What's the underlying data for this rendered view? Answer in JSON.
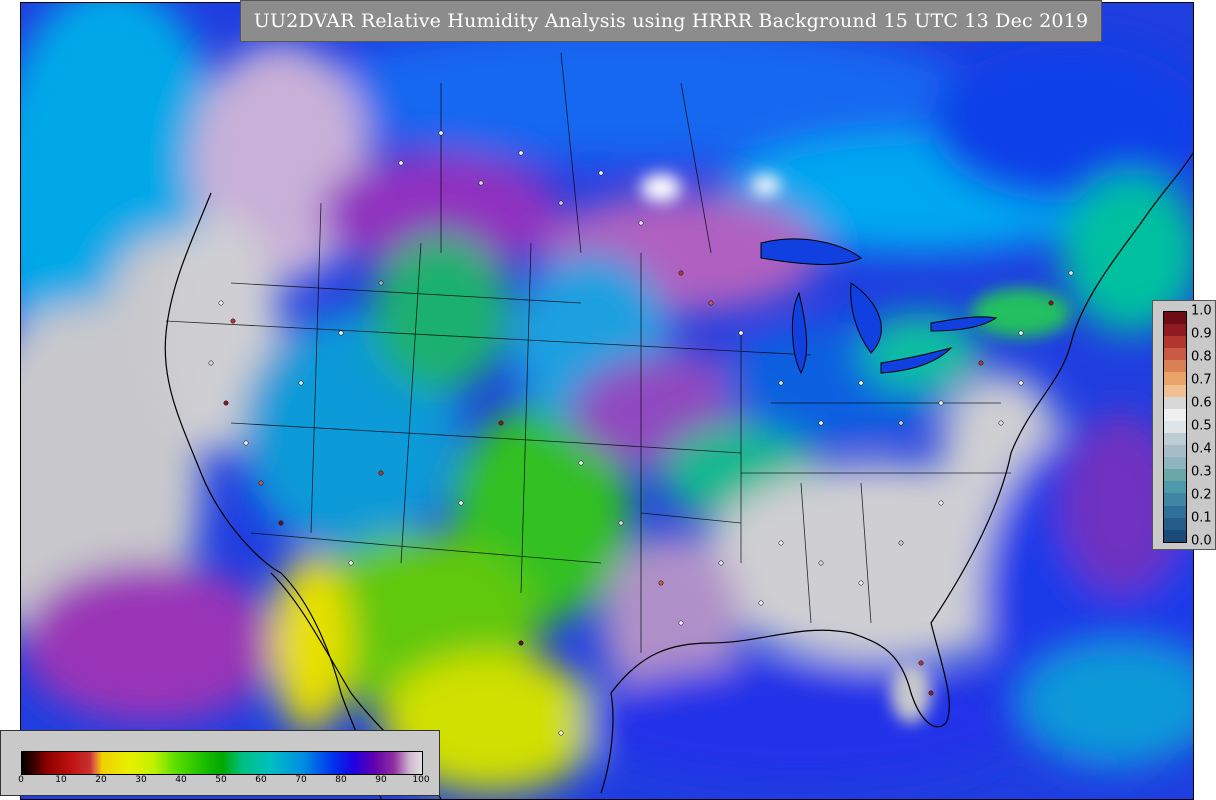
{
  "title": "UU2DVAR Relative Humidity Analysis using HRRR Background 15 UTC 13 Dec 2019",
  "rh_colorbar": {
    "ticks": [
      "0",
      "10",
      "20",
      "30",
      "40",
      "50",
      "60",
      "70",
      "80",
      "90",
      "100"
    ]
  },
  "obs_colorbar": {
    "ticks": [
      "1.0",
      "0.9",
      "0.8",
      "0.7",
      "0.6",
      "0.5",
      "0.4",
      "0.3",
      "0.2",
      "0.1",
      "0.0"
    ],
    "colors": [
      "#6e0d14",
      "#8f1a22",
      "#b3352e",
      "#c95a44",
      "#d98055",
      "#eaa46a",
      "#f0c090",
      "#d8d8d8",
      "#efefef",
      "#dde4ea",
      "#c0ccd4",
      "#a8bcc8",
      "#8fb4bf",
      "#6aa8a8",
      "#4f9aaa",
      "#3f86a4",
      "#2f709a",
      "#245d8a",
      "#1a4a78"
    ]
  }
}
